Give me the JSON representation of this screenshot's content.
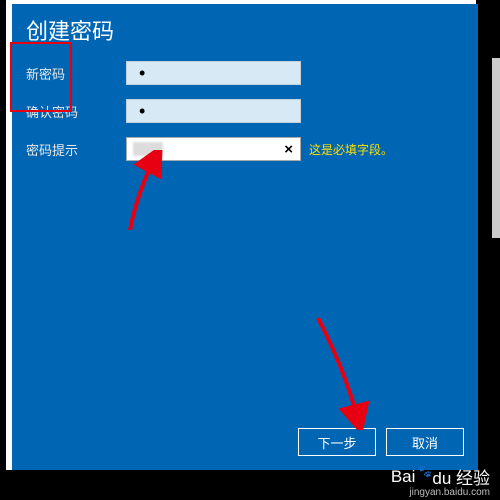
{
  "dialog": {
    "title": "创建密码",
    "new_password_label": "新密码",
    "new_password_value": "•",
    "confirm_password_label": "确认密码",
    "confirm_password_value": "•",
    "hint_label": "密码提示",
    "hint_clear": "×",
    "hint_error": "这是必填字段。",
    "next_button": "下一步",
    "cancel_button": "取消"
  },
  "watermark": {
    "brand": "Baidu 经验",
    "url": "jingyan.baidu.com"
  }
}
